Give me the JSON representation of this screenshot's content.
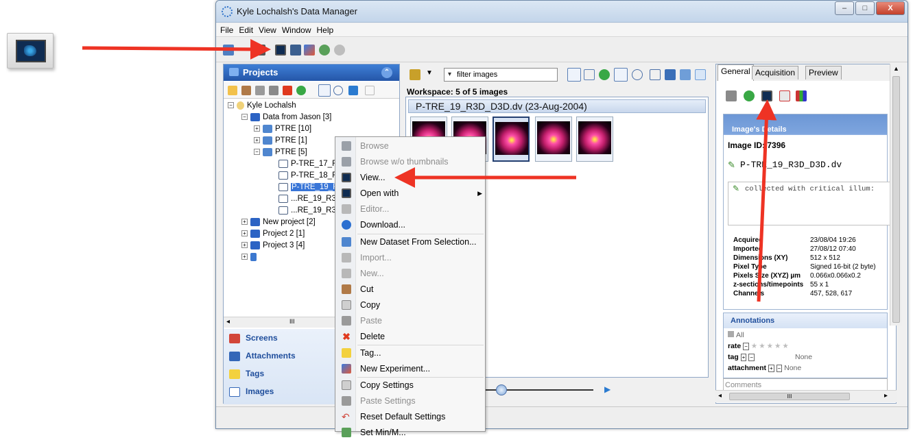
{
  "window": {
    "title": "Kyle Lochalsh's Data Manager",
    "min": "–",
    "max": "□",
    "close": "X"
  },
  "menubar": [
    "File",
    "Edit",
    "View",
    "Window",
    "Help"
  ],
  "projects": {
    "header": "Projects",
    "tree": {
      "user": "Kyle Lochalsh",
      "data_from": "Data from Jason [3]",
      "ptre10": "PTRE [10]",
      "ptre1": "PTRE [1]",
      "ptre5": "PTRE [5]",
      "img1": "P-TRE_17_R",
      "img2": "P-TRE_18_R",
      "img3": "P-TRE_19_R",
      "img4": "...RE_19_R3",
      "img5": "...RE_19_R3",
      "new_project": "New project [2]",
      "project2": "Project 2 [1]",
      "project3": "Project 3 [4]"
    },
    "scroll_label": "III",
    "panels": [
      "Screens",
      "Attachments",
      "Tags",
      "Images"
    ]
  },
  "center": {
    "filter_placeholder": "filter images",
    "workspace": "Workspace: 5 of 5 images",
    "dataset_title": "P-TRE_19_R3D_D3D.dv (23-Aug-2004)"
  },
  "context_menu": {
    "items": [
      {
        "label": "Browse",
        "disabled": true
      },
      {
        "label": "Browse w/o thumbnails",
        "disabled": true
      },
      {
        "label": "View...",
        "disabled": false
      },
      {
        "label": "Open with",
        "disabled": false
      },
      {
        "label": "Editor...",
        "disabled": true
      },
      {
        "label": "Download...",
        "disabled": false
      },
      {
        "label": "New Dataset From Selection...",
        "disabled": false
      },
      {
        "label": "Import...",
        "disabled": true
      },
      {
        "label": "New...",
        "disabled": true
      },
      {
        "label": "Cut",
        "disabled": false
      },
      {
        "label": "Copy",
        "disabled": false
      },
      {
        "label": "Paste",
        "disabled": true
      },
      {
        "label": "Delete",
        "disabled": false
      },
      {
        "label": "Tag...",
        "disabled": false
      },
      {
        "label": "New Experiment...",
        "disabled": false
      },
      {
        "label": "Copy Settings",
        "disabled": false
      },
      {
        "label": "Paste Settings",
        "disabled": true
      },
      {
        "label": "Reset Default Settings",
        "disabled": false
      },
      {
        "label": "Set Min/M...",
        "disabled": false
      }
    ]
  },
  "right": {
    "tabs": [
      "General",
      "Acquisition",
      "Preview"
    ],
    "details_header": "Image's Details",
    "image_id": "Image ID: 7396",
    "image_name": "P-TRE_19_R3D_D3D.dv",
    "description": "collected with critical illum:",
    "metadata": [
      {
        "k": "Acquired",
        "v": "23/08/04 19:26"
      },
      {
        "k": "Imported",
        "v": "27/08/12 07:40"
      },
      {
        "k": "Dimensions (XY)",
        "v": "512 x 512"
      },
      {
        "k": "Pixel Type",
        "v": "Signed 16-bit (2 byte)"
      },
      {
        "k": "Pixels Size (XYZ) µm",
        "v": "0.066x0.066x0.2"
      },
      {
        "k": "z-sections/timepoints",
        "v": "55 x 1"
      },
      {
        "k": "Channels",
        "v": "457, 528, 617"
      }
    ],
    "annotations": {
      "header": "Annotations",
      "all": "All",
      "rate": "rate",
      "tag": "tag",
      "tag_value": "None",
      "attachment": "attachment",
      "attachment_value": "None"
    },
    "comments_placeholder": "Comments",
    "scroll_label": "III"
  },
  "colors": {
    "accent": "#2556a8",
    "arrow": "#ee3324",
    "selection": "#3875d7"
  }
}
